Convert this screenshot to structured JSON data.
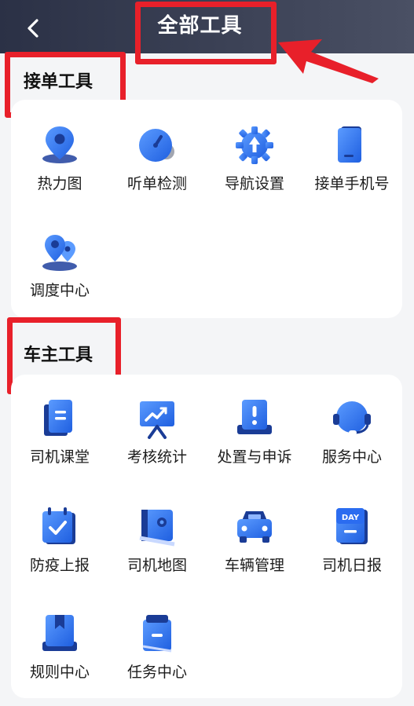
{
  "header": {
    "title": "全部工具"
  },
  "sections": [
    {
      "title": "接单工具",
      "items": [
        {
          "label": "热力图",
          "icon": "location-pin-icon"
        },
        {
          "label": "听单检测",
          "icon": "speedometer-icon"
        },
        {
          "label": "导航设置",
          "icon": "navigation-gear-icon"
        },
        {
          "label": "接单手机号",
          "icon": "phone-icon"
        },
        {
          "label": "调度中心",
          "icon": "dispatch-pins-icon"
        }
      ]
    },
    {
      "title": "车主工具",
      "items": [
        {
          "label": "司机课堂",
          "icon": "book-icon"
        },
        {
          "label": "考核统计",
          "icon": "chart-board-icon"
        },
        {
          "label": "处置与申诉",
          "icon": "alert-document-icon"
        },
        {
          "label": "服务中心",
          "icon": "headset-icon"
        },
        {
          "label": "防疫上报",
          "icon": "calendar-check-icon"
        },
        {
          "label": "司机地图",
          "icon": "map-icon"
        },
        {
          "label": "车辆管理",
          "icon": "car-icon"
        },
        {
          "label": "司机日报",
          "icon": "day-report-icon",
          "badge": "DAY"
        },
        {
          "label": "规则中心",
          "icon": "bookmark-book-icon"
        },
        {
          "label": "任务中心",
          "icon": "clipboard-icon"
        }
      ]
    }
  ],
  "colors": {
    "icon_light": "#5b9bff",
    "icon_dark": "#1f5fe0",
    "annotation": "#e8202a"
  }
}
